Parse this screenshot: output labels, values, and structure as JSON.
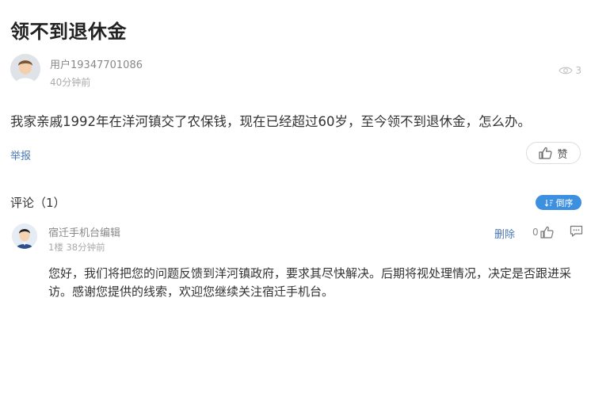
{
  "post": {
    "title": "领不到退休金",
    "author": "用户19347701086",
    "time": "40分钟前",
    "view_count": "3",
    "body": "我家亲戚1992年在洋河镇交了农保钱，现在已经超过60岁，至今领不到退休金，怎么办。",
    "report_label": "举报",
    "like_label": "赞"
  },
  "comments_section": {
    "label": "评论（1）",
    "sort_label": "倒序"
  },
  "comment": {
    "author": "宿迁手机台编辑",
    "meta": "1楼  38分钟前",
    "delete_label": "删除",
    "like_count": "0",
    "body": "您好，我们将把您的问题反馈到洋河镇政府，要求其尽快解决。后期将视处理情况，决定是否跟进采访。感谢您提供的线索，欢迎您继续关注宿迁手机台。"
  },
  "icons": {
    "views": "eye-icon",
    "like": "thumbs-up-icon",
    "sort": "sort-icon",
    "reply": "comment-bubble-icon"
  },
  "colors": {
    "link": "#4a78b6",
    "accent": "#3d8fe0"
  }
}
